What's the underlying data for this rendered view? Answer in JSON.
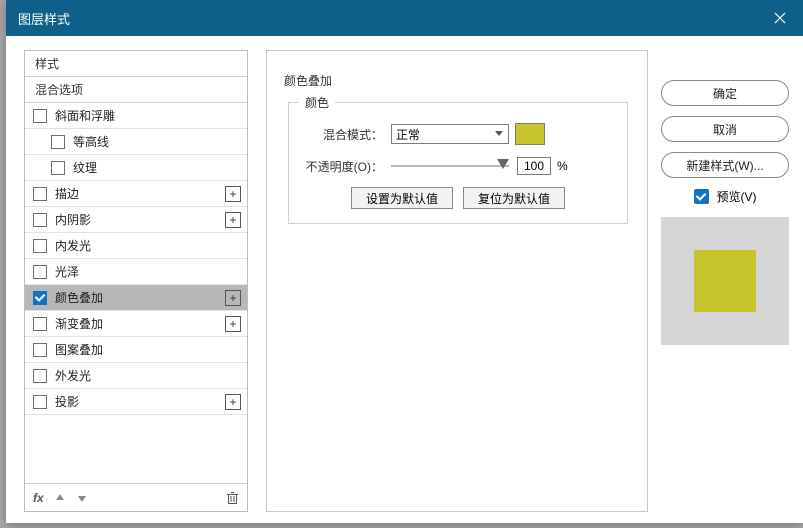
{
  "titlebar": {
    "title": "图层样式"
  },
  "left": {
    "header1": "样式",
    "header2": "混合选项",
    "effects": [
      {
        "label": "斜面和浮雕",
        "checked": false,
        "plus": false,
        "indent": false
      },
      {
        "label": "等高线",
        "checked": false,
        "plus": false,
        "indent": true
      },
      {
        "label": "纹理",
        "checked": false,
        "plus": false,
        "indent": true
      },
      {
        "label": "描边",
        "checked": false,
        "plus": true,
        "indent": false
      },
      {
        "label": "内阴影",
        "checked": false,
        "plus": true,
        "indent": false
      },
      {
        "label": "内发光",
        "checked": false,
        "plus": false,
        "indent": false
      },
      {
        "label": "光泽",
        "checked": false,
        "plus": false,
        "indent": false
      },
      {
        "label": "颜色叠加",
        "checked": true,
        "plus": true,
        "indent": false,
        "selected": true
      },
      {
        "label": "渐变叠加",
        "checked": false,
        "plus": true,
        "indent": false
      },
      {
        "label": "图案叠加",
        "checked": false,
        "plus": false,
        "indent": false
      },
      {
        "label": "外发光",
        "checked": false,
        "plus": false,
        "indent": false
      },
      {
        "label": "投影",
        "checked": false,
        "plus": true,
        "indent": false
      }
    ],
    "footer_fx": "fx"
  },
  "mid": {
    "group_title": "颜色叠加",
    "sub_title": "颜色",
    "blend_label": "混合模式：",
    "blend_value": "正常",
    "opacity_label": "不透明度(O)：",
    "opacity_value": "100",
    "opacity_unit": "%",
    "btn_default": "设置为默认值",
    "btn_reset": "复位为默认值",
    "swatch_color": "#c7c42d"
  },
  "right": {
    "ok": "确定",
    "cancel": "取消",
    "new_style": "新建样式(W)...",
    "preview_label": "预览(V)",
    "preview_checked": true,
    "preview_color": "#c7c42d"
  }
}
